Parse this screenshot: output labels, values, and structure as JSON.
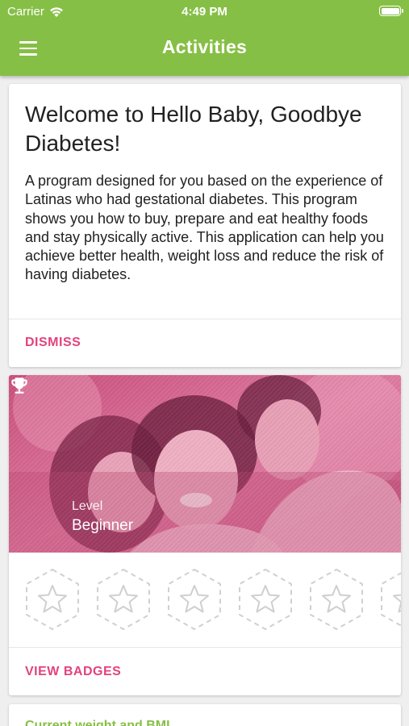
{
  "status_bar": {
    "carrier": "Carrier",
    "time": "4:49 PM"
  },
  "app_bar": {
    "title": "Activities"
  },
  "welcome_card": {
    "title": "Welcome to Hello Baby, Goodbye Diabetes!",
    "body": "A program designed for you based on the experience of Latinas who had gestational diabetes. This program shows you how to buy, prepare and eat healthy foods and stay physically active. This application can help you achieve better health, weight loss and reduce the risk of having diabetes.",
    "dismiss_label": "DISMISS"
  },
  "level_card": {
    "level_label": "Level",
    "level_value": "Beginner",
    "badge_count_visible": 6,
    "view_badges_label": "VIEW BADGES"
  },
  "weight_card": {
    "title": "Current weight and BMI"
  },
  "colors": {
    "app_bar": "#86bf45",
    "accent": "#e2437d",
    "hero_tint": "#d9658e"
  }
}
